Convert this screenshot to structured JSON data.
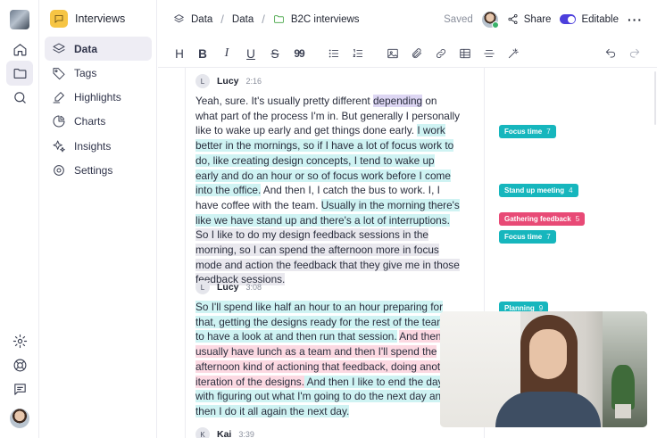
{
  "project": {
    "name": "Interviews"
  },
  "sidebar": {
    "items": [
      {
        "label": "Data",
        "icon": "layers-icon",
        "active": true
      },
      {
        "label": "Tags",
        "icon": "tag-icon"
      },
      {
        "label": "Highlights",
        "icon": "highlighter-icon"
      },
      {
        "label": "Charts",
        "icon": "pie-chart-icon"
      },
      {
        "label": "Insights",
        "icon": "sparkles-icon"
      },
      {
        "label": "Settings",
        "icon": "gear-icon"
      }
    ]
  },
  "breadcrumb": {
    "root": "Data",
    "middle": "Data",
    "current": "B2C interviews"
  },
  "topbar": {
    "status": "Saved",
    "share_label": "Share",
    "mode_label": "Editable"
  },
  "toolbar": {
    "heading_label": "H",
    "bold_label": "B",
    "italic_label": "I",
    "underline_label": "U",
    "strike_label": "S",
    "quote_label": "99"
  },
  "transcript": {
    "blocks": [
      {
        "initial": "L",
        "speaker": "Lucy",
        "time": "2:16",
        "segments": [
          "Yeah, sure. It's usually pretty different ",
          "depending",
          " on what part of the process I'm in. But generally I personally like to wake up early and get things done early. ",
          "I work better in the mornings, so if I have a lot of focus work to do, like creating design concepts, I tend to wake up early and do an hour or so of focus work before I come into the office.",
          " And then I, I catch the bus to work. I, I have coffee with the team. ",
          "Usually in the morning there's like we have stand up and there's a lot of interruptions.",
          " ",
          "So I like to do my design feedback sessions in the morning, so I can spend the afternoon more in focus mode and action the feedback that they give me in those feedback sessions."
        ]
      },
      {
        "initial": "L",
        "speaker": "Lucy",
        "time": "3:08",
        "segments": [
          "So I'll spend like half an hour to an hour preparing for that, getting the designs ready for the rest of the teams to have a look at and then run that session.",
          " ",
          "And then we usually have lunch as a team and then I'll spend the afternoon kind of actioning that feedback, doing another iteration of the designs.",
          " And then I like to end the day with figuring out what I'm going to do the next day and then I do it all again the next day."
        ]
      },
      {
        "initial": "K",
        "speaker": "Kai",
        "time": "3:39"
      }
    ]
  },
  "tags": [
    {
      "label": "Focus time",
      "count": "7",
      "color": "#16b6bd"
    },
    {
      "label": "Stand up meeting",
      "count": "4",
      "color": "#16b6bd"
    },
    {
      "label": "Gathering feedback",
      "count": "5",
      "color": "#e84a76"
    },
    {
      "label": "Focus time",
      "count": "7",
      "color": "#16b6bd"
    },
    {
      "label": "Planning",
      "count": "9",
      "color": "#16b6bd"
    }
  ]
}
